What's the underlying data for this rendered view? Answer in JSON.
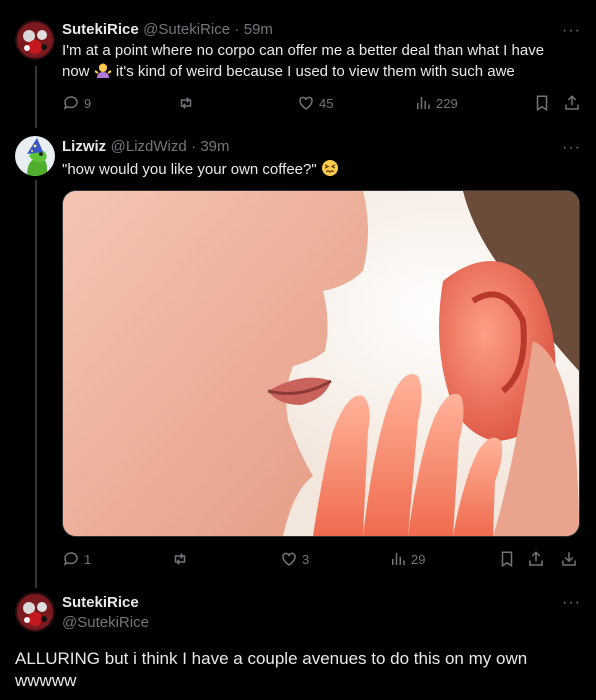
{
  "tweet1": {
    "display_name": "SutekiRice",
    "handle": "@SutekiRice",
    "time": "· 59m",
    "text_a": "I'm at a point where no corpo can offer me a better deal than what I have",
    "text_b_pre": "now",
    "text_b_post": " it's kind of weird because I used to view them with such awe",
    "emoji": "woman-shrugging-emoji",
    "more": "···",
    "replies": "9",
    "retweets": "",
    "likes": "45",
    "views": "229"
  },
  "tweet2": {
    "display_name": "Lizwiz",
    "handle": "@LizdWizd",
    "time": "· 39m",
    "text_pre": "\"how would you like your own coffee?\" ",
    "emoji": "confounded-face-emoji",
    "more": "···",
    "replies": "1",
    "retweets": "",
    "likes": "3",
    "views": "29"
  },
  "tweet3": {
    "display_name": "SutekiRice",
    "handle": "@SutekiRice",
    "more": "···",
    "text_a": "ALLURING but i think I have a couple avenues to do this on my own",
    "text_b": "wwwww"
  },
  "colors": {
    "background": "#000000",
    "text": "#e7e9ea",
    "muted": "#71767b",
    "thread_line": "#333639"
  }
}
